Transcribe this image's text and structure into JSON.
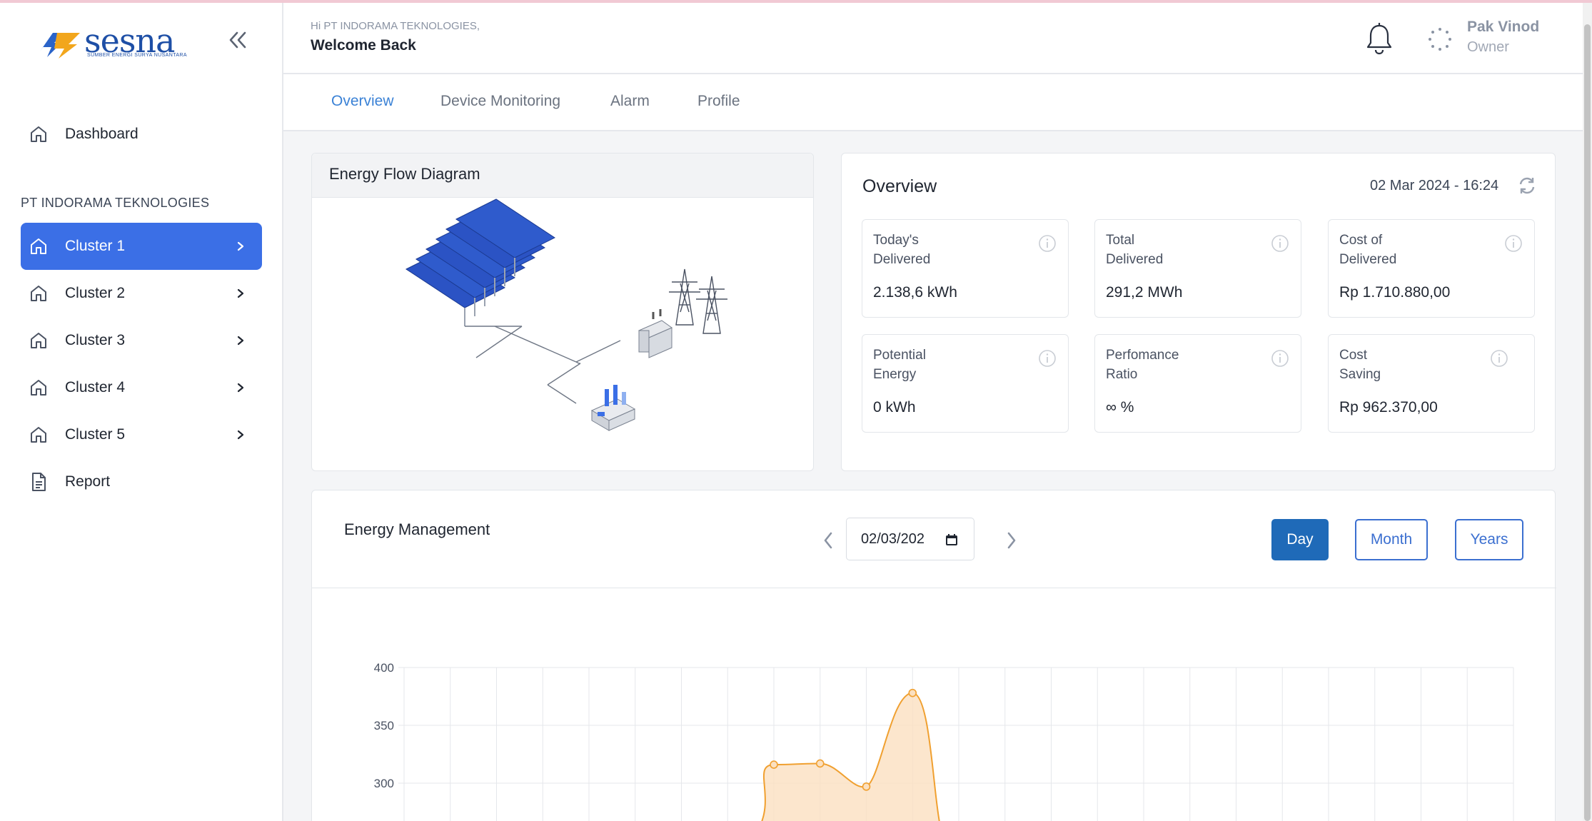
{
  "brand": {
    "name": "sesna",
    "tagline": "SUMBER ENERGI SURYA NUSANTARA"
  },
  "sidebar": {
    "dashboard_label": "Dashboard",
    "section_label": "PT INDORAMA TEKNOLOGIES",
    "clusters": [
      {
        "label": "Cluster 1",
        "active": true
      },
      {
        "label": "Cluster 2",
        "active": false
      },
      {
        "label": "Cluster 3",
        "active": false
      },
      {
        "label": "Cluster 4",
        "active": false
      },
      {
        "label": "Cluster 5",
        "active": false
      }
    ],
    "report_label": "Report"
  },
  "header": {
    "greeting": "Hi PT INDORAMA TEKNOLOGIES,",
    "welcome": "Welcome Back",
    "user_name": "Pak Vinod",
    "user_role": "Owner"
  },
  "tabs": [
    "Overview",
    "Device Monitoring",
    "Alarm",
    "Profile"
  ],
  "energy_flow": {
    "title": "Energy Flow Diagram"
  },
  "overview": {
    "title": "Overview",
    "datetime": "02 Mar 2024 - 16:24",
    "stats": [
      {
        "label1": "Today's",
        "label2": "Delivered",
        "value": "2.138,6 kWh"
      },
      {
        "label1": "Total",
        "label2": "Delivered",
        "value": "291,2 MWh"
      },
      {
        "label1": "Cost of",
        "label2": "Delivered",
        "value": "Rp 1.710.880,00"
      },
      {
        "label1": "Potential",
        "label2": "Energy",
        "value": "0 kWh"
      },
      {
        "label1": "Perfomance",
        "label2": "Ratio",
        "value": "∞ %"
      },
      {
        "label1": "Cost",
        "label2": "Saving",
        "value": "Rp 962.370,00"
      }
    ]
  },
  "energy_management": {
    "title": "Energy Management",
    "date_value": "02/03/202",
    "buttons": {
      "day": "Day",
      "month": "Month",
      "years": "Years"
    }
  },
  "colors": {
    "accent": "#3b6fe6",
    "primary_button": "#1f6ab8",
    "series_line": "#f0a030",
    "series_fill": "#fbe0c0"
  },
  "chart_data": {
    "type": "area",
    "title": "",
    "xlabel": "",
    "ylabel": "",
    "y_ticks": [
      400,
      350,
      300
    ],
    "ylim": [
      280,
      400
    ],
    "x": [
      0,
      1,
      2,
      3,
      4,
      5,
      6,
      7,
      8,
      9,
      10,
      11,
      12,
      13,
      14,
      15,
      16,
      17,
      18,
      19,
      20,
      21,
      22,
      23,
      24
    ],
    "points": [
      {
        "x": 8,
        "y": 316
      },
      {
        "x": 9,
        "y": 317
      },
      {
        "x": 10,
        "y": 297
      },
      {
        "x": 11,
        "y": 378
      }
    ],
    "grid": true
  }
}
